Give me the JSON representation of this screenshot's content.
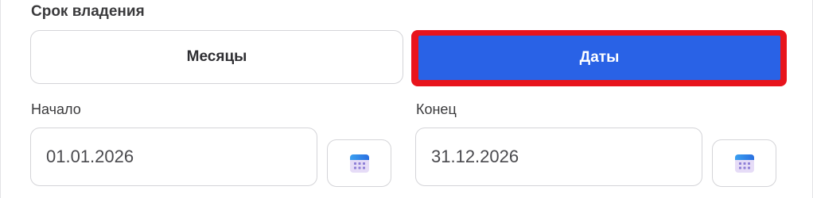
{
  "ownership": {
    "title": "Срок владения",
    "modes": {
      "months_label": "Месяцы",
      "dates_label": "Даты",
      "selected": "Даты"
    }
  },
  "start": {
    "label": "Начало",
    "value": "01.01.2026"
  },
  "end": {
    "label": "Конец",
    "value": "31.12.2026"
  },
  "icons": {
    "calendar": "calendar-icon"
  },
  "colors": {
    "accent": "#2962e6",
    "highlight": "#e8141c"
  }
}
